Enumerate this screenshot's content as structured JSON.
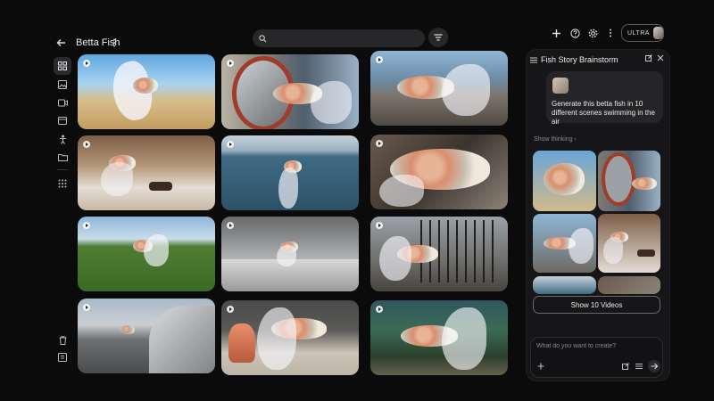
{
  "header": {
    "title": "Betta Fish",
    "search_placeholder": "",
    "plan_badge": "ULTRA"
  },
  "panel": {
    "title": "Fish Story Brainstorm",
    "message": "Generate this betta fish in 10 different scenes swimming in the air",
    "show_thinking": "Show thinking",
    "show_videos_label": "Show 10 Videos",
    "composer_placeholder": "What do you want to create?"
  },
  "icons": {
    "back": "arrow-left-icon",
    "more": "kebab-icon",
    "search": "search-icon",
    "filter": "filter-icon",
    "add": "plus-icon",
    "help": "help-icon",
    "settings": "gear-icon",
    "close": "close-icon",
    "edit": "edit-icon"
  },
  "colors": {
    "background": "#0b0b0c",
    "panel": "#161618",
    "accent_border": "#6a6a6e"
  }
}
